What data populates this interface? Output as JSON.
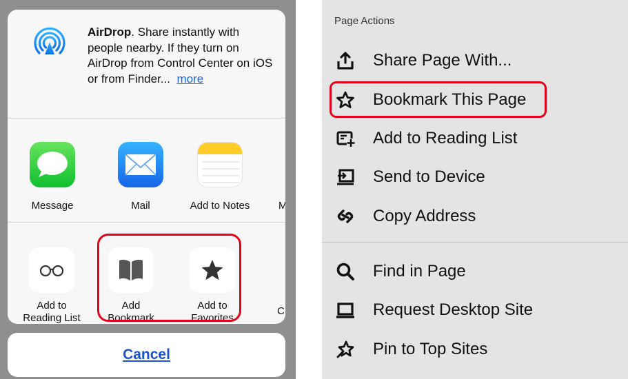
{
  "share_sheet": {
    "airdrop": {
      "title": "AirDrop",
      "description": ". Share instantly with people nearby. If they turn on AirDrop from Control Center on iOS or from Finder...",
      "more_link": "more"
    },
    "apps": [
      {
        "label": "Message",
        "icon": "message-icon"
      },
      {
        "label": "Mail",
        "icon": "mail-icon"
      },
      {
        "label": "Add to Notes",
        "icon": "notes-icon"
      },
      {
        "label": "M",
        "icon": "more-apps-icon"
      }
    ],
    "actions": [
      {
        "label": "Add to\nReading List",
        "icon": "reading-list-icon"
      },
      {
        "label": "Add\nBookmark",
        "icon": "bookmark-icon"
      },
      {
        "label": "Add to\nFavorites",
        "icon": "star-icon"
      },
      {
        "label": "C",
        "icon": "copy-icon"
      }
    ],
    "cancel_label": "Cancel",
    "highlight_color": "#e3001b"
  },
  "page_actions": {
    "header": "Page Actions",
    "items": [
      {
        "label": "Share Page With...",
        "icon": "share-icon"
      },
      {
        "label": "Bookmark This Page",
        "icon": "star-outline-icon",
        "highlighted": true
      },
      {
        "label": "Add to Reading List",
        "icon": "reading-list-icon"
      },
      {
        "label": "Send to Device",
        "icon": "send-to-device-icon"
      },
      {
        "label": "Copy Address",
        "icon": "link-icon"
      },
      {
        "label": "Find in Page",
        "icon": "search-icon"
      },
      {
        "label": "Request Desktop Site",
        "icon": "laptop-icon"
      },
      {
        "label": "Pin to Top Sites",
        "icon": "pin-icon"
      }
    ]
  }
}
